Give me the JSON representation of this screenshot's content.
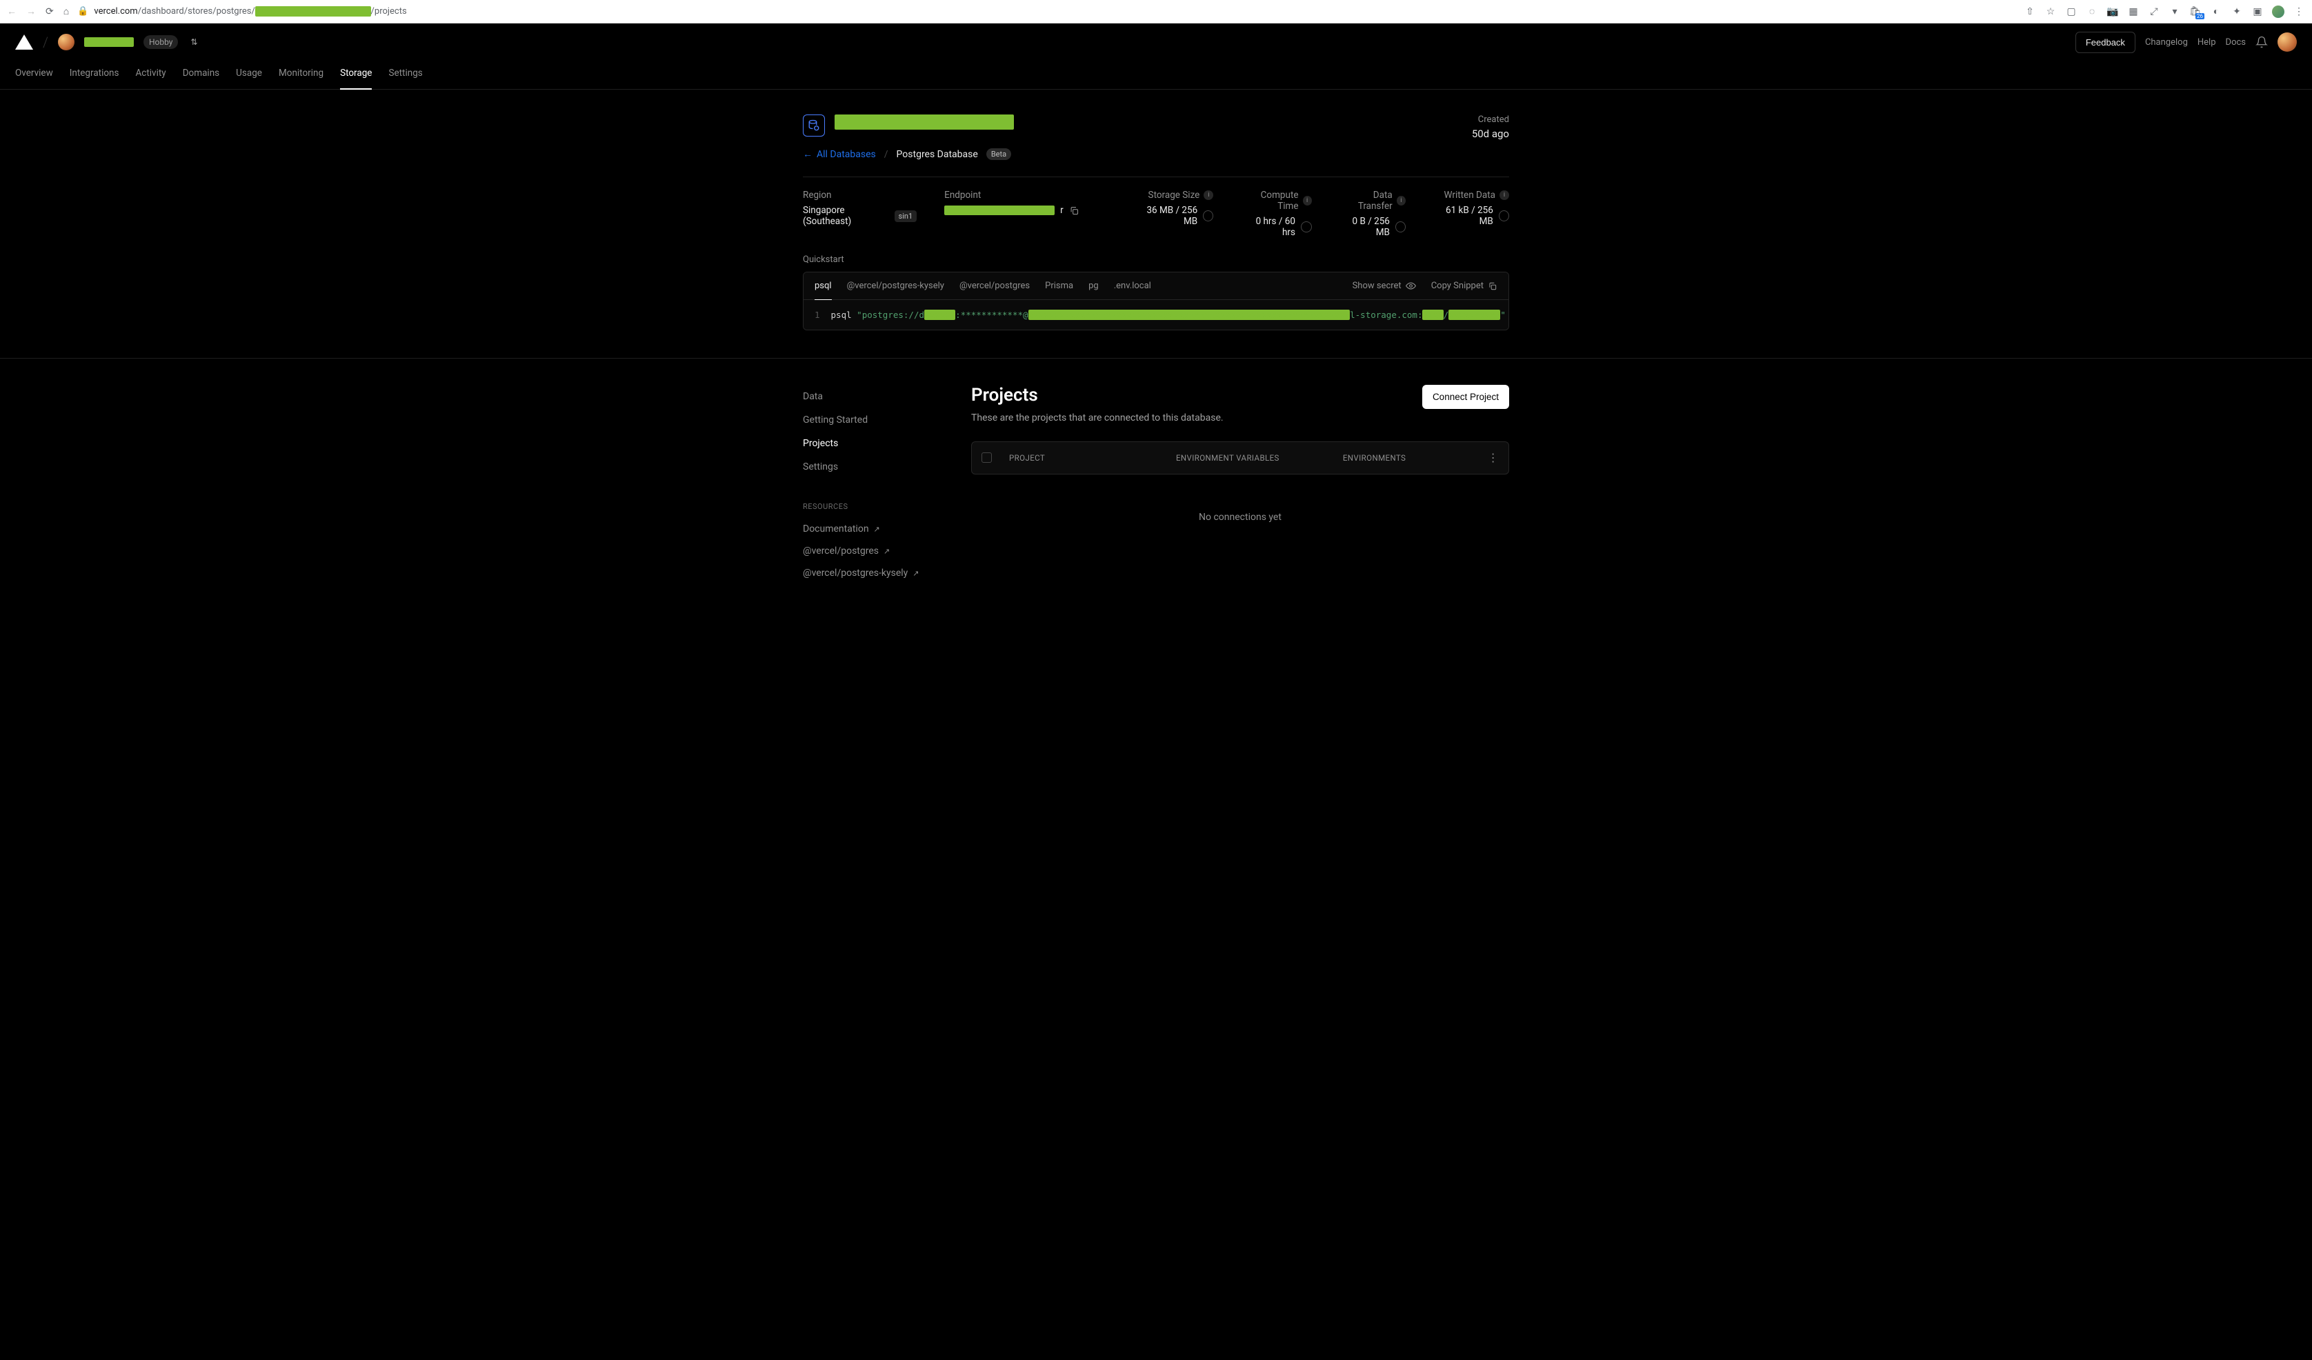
{
  "browser": {
    "url_prefix": "vercel.com",
    "url_mid": "/dashboard/stores/postgres/",
    "url_redacted": "xxxxxxxxxxxxxxxxxxxxxxxxxx",
    "url_suffix": "/projects"
  },
  "topbar": {
    "plan_badge": "Hobby",
    "feedback": "Feedback",
    "links": {
      "changelog": "Changelog",
      "help": "Help",
      "docs": "Docs"
    }
  },
  "nav_tabs": [
    "Overview",
    "Integrations",
    "Activity",
    "Domains",
    "Usage",
    "Monitoring",
    "Storage",
    "Settings"
  ],
  "nav_active": "Storage",
  "db": {
    "created_label": "Created",
    "created_value": "50d ago",
    "back_label": "All Databases",
    "type_label": "Postgres Database",
    "beta": "Beta"
  },
  "stats": {
    "region_label": "Region",
    "region_value": "Singapore (Southeast)",
    "region_tag": "sin1",
    "endpoint_label": "Endpoint",
    "endpoint_redacted_suffix": "r",
    "storage_label": "Storage Size",
    "storage_value": "36 MB / 256 MB",
    "compute_label": "Compute Time",
    "compute_value": "0 hrs / 60 hrs",
    "transfer_label": "Data Transfer",
    "transfer_value": "0 B / 256 MB",
    "written_label": "Written Data",
    "written_value": "61 kB / 256 MB"
  },
  "quickstart": {
    "title": "Quickstart",
    "tabs": [
      "psql",
      "@vercel/postgres-kysely",
      "@vercel/postgres",
      "Prisma",
      "pg",
      ".env.local"
    ],
    "active": "psql",
    "show_secret": "Show secret",
    "copy_snippet": "Copy Snippet",
    "line_no": "1",
    "cmd": "psql ",
    "conn_prefix": "\"postgres://d",
    "conn_redact1": "xxxxxx",
    "conn_mid1": ":************@",
    "conn_redact2": "xxxxxxxxxxxxxxxxxxxxxxxxxxxxxxxxxxxxxxxxxxxxxxxxxxxxxxxxxxxxxx",
    "conn_mid2": "l-storage.com:",
    "conn_redact3": "xxxx",
    "conn_mid3": "/",
    "conn_redact4": "xxxxxxxxxx",
    "conn_suffix": "\""
  },
  "sidebar": {
    "items": [
      "Data",
      "Getting Started",
      "Projects",
      "Settings"
    ],
    "active": "Projects",
    "resources_head": "RESOURCES",
    "resources": [
      "Documentation",
      "@vercel/postgres",
      "@vercel/postgres-kysely"
    ]
  },
  "projects": {
    "title": "Projects",
    "subtitle": "These are the projects that are connected to this database.",
    "connect_button": "Connect Project",
    "col_project": "PROJECT",
    "col_env_vars": "ENVIRONMENT VARIABLES",
    "col_envs": "ENVIRONMENTS",
    "empty": "No connections yet"
  }
}
